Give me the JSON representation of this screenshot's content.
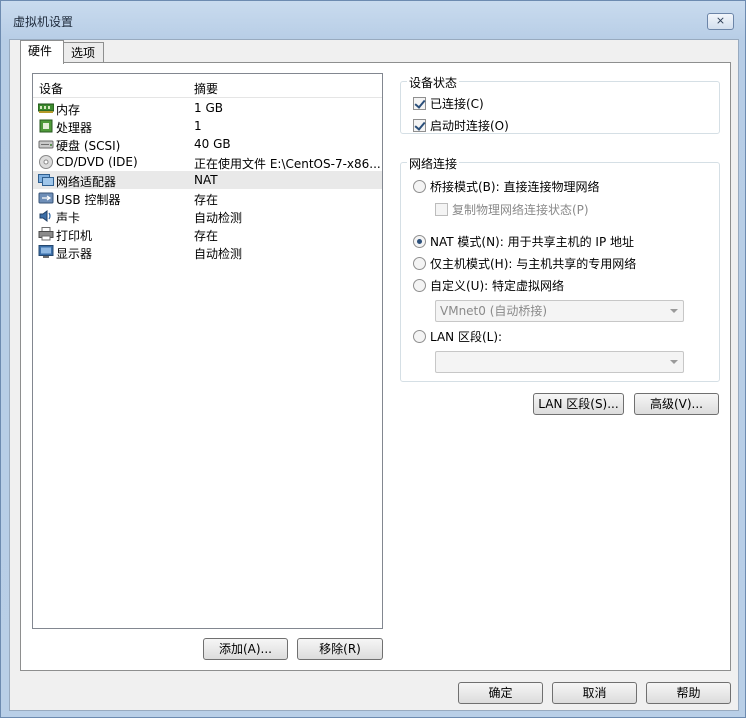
{
  "window": {
    "title": "虚拟机设置",
    "close_label": "⨯"
  },
  "tabs": [
    {
      "label": "硬件",
      "active": true
    },
    {
      "label": "选项",
      "active": false
    }
  ],
  "device_list": {
    "columns": [
      "设备",
      "摘要"
    ],
    "rows": [
      {
        "name": "内存",
        "summary": "1 GB",
        "icon": "memory-icon"
      },
      {
        "name": "处理器",
        "summary": "1",
        "icon": "processor-icon"
      },
      {
        "name": "硬盘 (SCSI)",
        "summary": "40 GB",
        "icon": "hard-disk-icon"
      },
      {
        "name": "CD/DVD (IDE)",
        "summary": "正在使用文件 E:\\CentOS-7-x86...",
        "icon": "cd-dvd-icon"
      },
      {
        "name": "网络适配器",
        "summary": "NAT",
        "icon": "network-adapter-icon",
        "selected": true
      },
      {
        "name": "USB 控制器",
        "summary": "存在",
        "icon": "usb-icon"
      },
      {
        "name": "声卡",
        "summary": "自动检测",
        "icon": "sound-card-icon"
      },
      {
        "name": "打印机",
        "summary": "存在",
        "icon": "printer-icon"
      },
      {
        "name": "显示器",
        "summary": "自动检测",
        "icon": "display-icon"
      }
    ],
    "add_label": "添加(A)...",
    "remove_label": "移除(R)"
  },
  "device_status": {
    "label": "设备状态",
    "connected": {
      "label": "已连接(C)",
      "checked": true
    },
    "connect_at_power_on": {
      "label": "启动时连接(O)",
      "checked": true
    }
  },
  "network": {
    "label": "网络连接",
    "bridged": {
      "label": "桥接模式(B): 直接连接物理网络",
      "checked": false
    },
    "replicate": {
      "label": "复制物理网络连接状态(P)",
      "checked": false
    },
    "nat": {
      "label": "NAT 模式(N): 用于共享主机的 IP 地址",
      "checked": true
    },
    "host_only": {
      "label": "仅主机模式(H): 与主机共享的专用网络",
      "checked": false
    },
    "custom": {
      "label": "自定义(U): 特定虚拟网络",
      "checked": false
    },
    "custom_select": "VMnet0 (自动桥接)",
    "lan_segment": {
      "label": "LAN 区段(L):",
      "checked": false
    },
    "lan_select": ""
  },
  "buttons": {
    "lan_segments": "LAN 区段(S)...",
    "advanced": "高级(V)...",
    "ok": "确定",
    "cancel": "取消",
    "help": "帮助"
  },
  "colors": {
    "accent": "#2b4f7a",
    "title_bar": "#c9dbee",
    "selected_row": "#e9e9e9"
  }
}
